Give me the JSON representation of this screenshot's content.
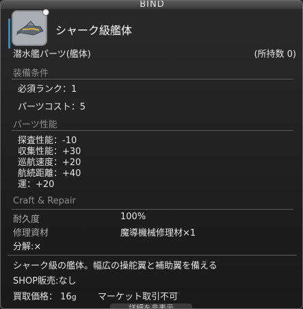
{
  "header": {
    "bind_label": "BIND"
  },
  "item": {
    "name": "シャーク級艦体",
    "category": "潜水艦パーツ(艦体)",
    "owned": "(所持数 0)"
  },
  "requirements": {
    "title": "装備条件",
    "rank": "必須ランク：1",
    "cost": "パーツコスト：5"
  },
  "performance": {
    "title": "パーツ性能",
    "stats": [
      "探査性能：-10",
      "収集性能：+30",
      "巡航速度：+20",
      "航続距離：+40",
      "運：+20"
    ]
  },
  "craft": {
    "title": "Craft & Repair",
    "durability_label": "耐久度",
    "durability_value": "100%",
    "repair_label": "修理資材",
    "repair_value": "魔導機械修理材×1",
    "desynth": "分解:×"
  },
  "description": {
    "text": "シャーク級の艦体。幅広の操舵翼と補助翼を備える",
    "shop": "SHOP販売:なし",
    "buy_price_label": "買取価格：",
    "buy_price_value": "16",
    "gil_symbol": "g",
    "market": "マーケット取引不可"
  },
  "footer": {
    "tab_label": "詳細を非表示"
  }
}
